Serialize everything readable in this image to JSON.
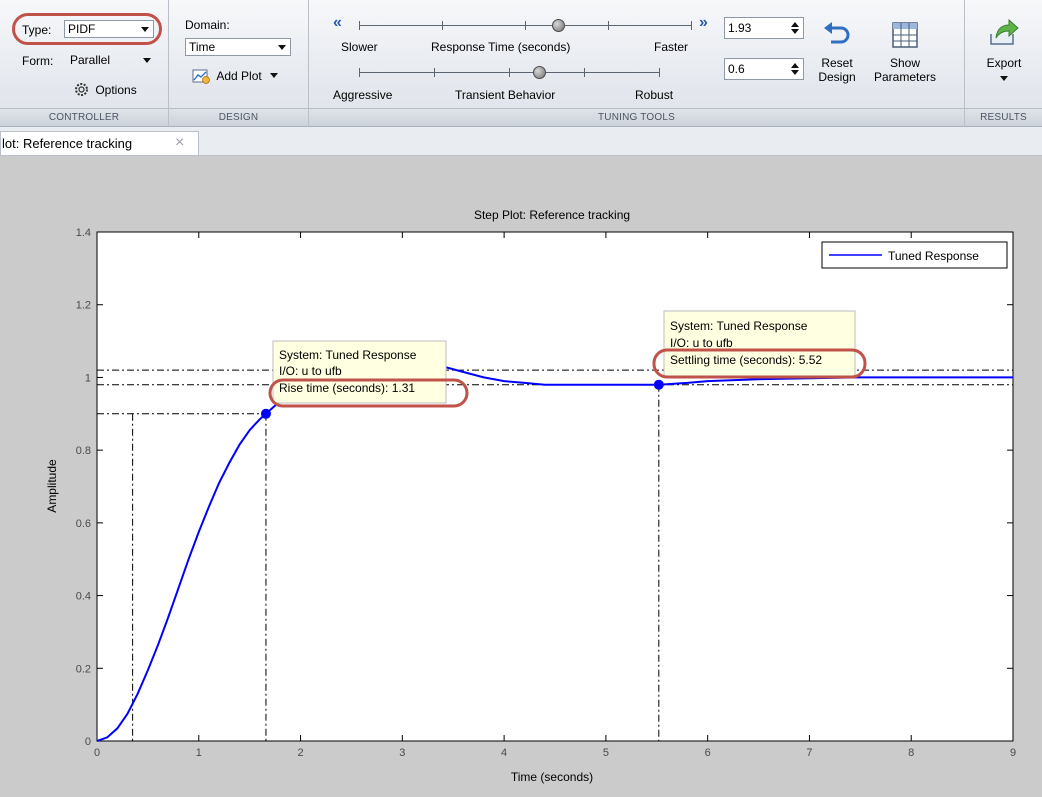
{
  "toolstrip": {
    "controller": {
      "type_label": "Type:",
      "type_value": "PIDF",
      "form_label": "Form:",
      "form_value": "Parallel",
      "options_label": "Options",
      "section_label": "CONTROLLER"
    },
    "design": {
      "domain_label": "Domain:",
      "domain_value": "Time",
      "add_plot_label": "Add Plot",
      "section_label": "DESIGN"
    },
    "tuning": {
      "left_arrow": "«",
      "right_arrow": "»",
      "response_time": {
        "left_label": "Slower",
        "center_label": "Response Time (seconds)",
        "right_label": "Faster",
        "value": "1.93",
        "slider_position": 0.6
      },
      "transient": {
        "left_label": "Aggressive",
        "center_label": "Transient Behavior",
        "right_label": "Robust",
        "value": "0.6",
        "slider_position": 0.6
      },
      "reset_label_1": "Reset",
      "reset_label_2": "Design",
      "show_label_1": "Show",
      "show_label_2": "Parameters",
      "section_label": "TUNING TOOLS"
    },
    "results": {
      "export_label": "Export",
      "section_label": "RESULTS"
    }
  },
  "tab": {
    "label": "lot: Reference tracking",
    "close": "×"
  },
  "plot": {
    "title": "Step Plot: Reference tracking",
    "legend": "Tuned Response",
    "datatips": [
      {
        "line1": "System: Tuned Response",
        "line2": "I/O: u to ufb",
        "line3": "Rise time (seconds): 1.31"
      },
      {
        "line1": "System: Tuned Response",
        "line2": "I/O: u to ufb",
        "line3": "Settling time (seconds): 5.52"
      }
    ]
  },
  "chart_data": {
    "type": "line",
    "title": "Step Plot: Reference tracking",
    "xlabel": "Time (seconds)",
    "ylabel": "Amplitude",
    "xlim": [
      0,
      9
    ],
    "ylim": [
      0,
      1.4
    ],
    "xticks": [
      0,
      1,
      2,
      3,
      4,
      5,
      6,
      7,
      8,
      9
    ],
    "yticks": [
      0,
      0.2,
      0.4,
      0.6,
      0.8,
      1,
      1.2,
      1.4
    ],
    "ytick_labels": [
      "0",
      "0.2",
      "0.4",
      "0.6",
      "0.8",
      "1",
      "1.2",
      "1.4"
    ],
    "legend_position": "top-right",
    "series": [
      {
        "name": "Tuned Response",
        "color": "#0000ff",
        "x": [
          0,
          0.1,
          0.2,
          0.3,
          0.4,
          0.5,
          0.6,
          0.7,
          0.8,
          0.9,
          1.0,
          1.1,
          1.2,
          1.3,
          1.4,
          1.5,
          1.6,
          1.7,
          1.8,
          1.9,
          2.0,
          2.2,
          2.4,
          2.6,
          2.8,
          3.0,
          3.2,
          3.4,
          3.6,
          3.8,
          4.0,
          4.2,
          4.4,
          4.6,
          4.8,
          5.0,
          5.2,
          5.52,
          5.8,
          6.0,
          6.5,
          7.0,
          7.5,
          8.0,
          8.5,
          9.0
        ],
        "y": [
          0,
          0.01,
          0.035,
          0.075,
          0.13,
          0.195,
          0.265,
          0.34,
          0.42,
          0.5,
          0.575,
          0.645,
          0.71,
          0.765,
          0.815,
          0.855,
          0.885,
          0.91,
          0.935,
          0.955,
          0.975,
          1.0,
          1.015,
          1.025,
          1.03,
          1.035,
          1.035,
          1.03,
          1.015,
          1.0,
          0.99,
          0.985,
          0.98,
          0.98,
          0.98,
          0.98,
          0.98,
          0.98,
          0.985,
          0.99,
          0.995,
          0.998,
          1.0,
          1.0,
          1.0,
          1.0
        ]
      }
    ],
    "markers": [
      {
        "name": "rise-start",
        "x": 0.35,
        "y": 0.1
      },
      {
        "name": "rise-end",
        "x": 1.66,
        "y": 0.9
      },
      {
        "name": "settling",
        "x": 5.52,
        "y": 0.98
      }
    ],
    "reference_lines_y": [
      0.9,
      0.98,
      1.02
    ]
  }
}
